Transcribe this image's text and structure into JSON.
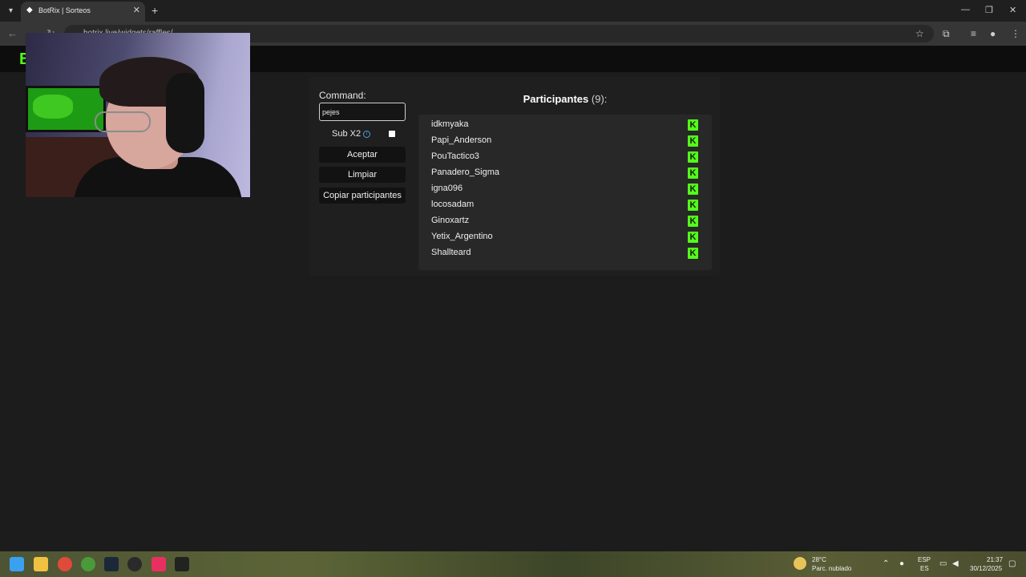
{
  "browser": {
    "tab_title": "BotRix | Sorteos",
    "url": "botrix.live/widgets/raffles/"
  },
  "form": {
    "command_label": "Command:",
    "command_value": "pejes",
    "sub_label": "Sub X2",
    "accept_label": "Aceptar",
    "clear_label": "Limpiar",
    "copy_label": "Copiar participantes"
  },
  "participants": {
    "title": "Participantes",
    "count": "(9):",
    "names": [
      "idkmyaka",
      "Papi_Anderson",
      "PouTactico3",
      "Panadero_Sigma",
      "igna096",
      "locosadam",
      "Ginoxartz",
      "Yetix_Argentino",
      "Shallteard"
    ]
  },
  "taskbar": {
    "weather_temp": "28°C",
    "weather_desc": "Parc. nublado",
    "lang_top": "ESP",
    "lang_bottom": "ES",
    "time": "21:37",
    "date": "30/12/2025"
  },
  "colors": {
    "kick_green": "#53fc18",
    "page_bg": "#1c1c1c",
    "panel_bg": "#1f1f1f"
  }
}
